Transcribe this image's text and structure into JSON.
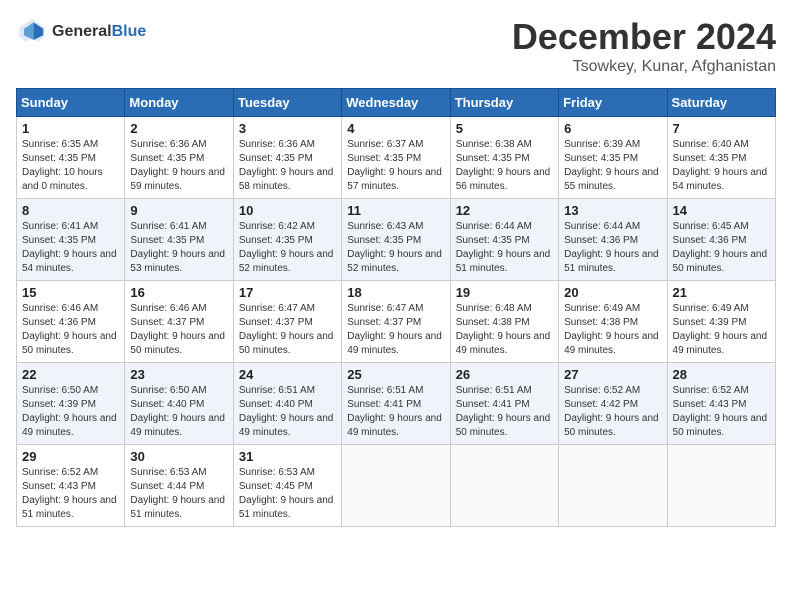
{
  "header": {
    "logo": {
      "general": "General",
      "blue": "Blue"
    },
    "title": "December 2024",
    "location": "Tsowkey, Kunar, Afghanistan"
  },
  "calendar": {
    "days_of_week": [
      "Sunday",
      "Monday",
      "Tuesday",
      "Wednesday",
      "Thursday",
      "Friday",
      "Saturday"
    ],
    "weeks": [
      [
        {
          "day": 1,
          "sunrise": "6:35 AM",
          "sunset": "4:35 PM",
          "daylight": "10 hours and 0 minutes."
        },
        {
          "day": 2,
          "sunrise": "6:36 AM",
          "sunset": "4:35 PM",
          "daylight": "9 hours and 59 minutes."
        },
        {
          "day": 3,
          "sunrise": "6:36 AM",
          "sunset": "4:35 PM",
          "daylight": "9 hours and 58 minutes."
        },
        {
          "day": 4,
          "sunrise": "6:37 AM",
          "sunset": "4:35 PM",
          "daylight": "9 hours and 57 minutes."
        },
        {
          "day": 5,
          "sunrise": "6:38 AM",
          "sunset": "4:35 PM",
          "daylight": "9 hours and 56 minutes."
        },
        {
          "day": 6,
          "sunrise": "6:39 AM",
          "sunset": "4:35 PM",
          "daylight": "9 hours and 55 minutes."
        },
        {
          "day": 7,
          "sunrise": "6:40 AM",
          "sunset": "4:35 PM",
          "daylight": "9 hours and 54 minutes."
        }
      ],
      [
        {
          "day": 8,
          "sunrise": "6:41 AM",
          "sunset": "4:35 PM",
          "daylight": "9 hours and 54 minutes."
        },
        {
          "day": 9,
          "sunrise": "6:41 AM",
          "sunset": "4:35 PM",
          "daylight": "9 hours and 53 minutes."
        },
        {
          "day": 10,
          "sunrise": "6:42 AM",
          "sunset": "4:35 PM",
          "daylight": "9 hours and 52 minutes."
        },
        {
          "day": 11,
          "sunrise": "6:43 AM",
          "sunset": "4:35 PM",
          "daylight": "9 hours and 52 minutes."
        },
        {
          "day": 12,
          "sunrise": "6:44 AM",
          "sunset": "4:35 PM",
          "daylight": "9 hours and 51 minutes."
        },
        {
          "day": 13,
          "sunrise": "6:44 AM",
          "sunset": "4:36 PM",
          "daylight": "9 hours and 51 minutes."
        },
        {
          "day": 14,
          "sunrise": "6:45 AM",
          "sunset": "4:36 PM",
          "daylight": "9 hours and 50 minutes."
        }
      ],
      [
        {
          "day": 15,
          "sunrise": "6:46 AM",
          "sunset": "4:36 PM",
          "daylight": "9 hours and 50 minutes."
        },
        {
          "day": 16,
          "sunrise": "6:46 AM",
          "sunset": "4:37 PM",
          "daylight": "9 hours and 50 minutes."
        },
        {
          "day": 17,
          "sunrise": "6:47 AM",
          "sunset": "4:37 PM",
          "daylight": "9 hours and 50 minutes."
        },
        {
          "day": 18,
          "sunrise": "6:47 AM",
          "sunset": "4:37 PM",
          "daylight": "9 hours and 49 minutes."
        },
        {
          "day": 19,
          "sunrise": "6:48 AM",
          "sunset": "4:38 PM",
          "daylight": "9 hours and 49 minutes."
        },
        {
          "day": 20,
          "sunrise": "6:49 AM",
          "sunset": "4:38 PM",
          "daylight": "9 hours and 49 minutes."
        },
        {
          "day": 21,
          "sunrise": "6:49 AM",
          "sunset": "4:39 PM",
          "daylight": "9 hours and 49 minutes."
        }
      ],
      [
        {
          "day": 22,
          "sunrise": "6:50 AM",
          "sunset": "4:39 PM",
          "daylight": "9 hours and 49 minutes."
        },
        {
          "day": 23,
          "sunrise": "6:50 AM",
          "sunset": "4:40 PM",
          "daylight": "9 hours and 49 minutes."
        },
        {
          "day": 24,
          "sunrise": "6:51 AM",
          "sunset": "4:40 PM",
          "daylight": "9 hours and 49 minutes."
        },
        {
          "day": 25,
          "sunrise": "6:51 AM",
          "sunset": "4:41 PM",
          "daylight": "9 hours and 49 minutes."
        },
        {
          "day": 26,
          "sunrise": "6:51 AM",
          "sunset": "4:41 PM",
          "daylight": "9 hours and 50 minutes."
        },
        {
          "day": 27,
          "sunrise": "6:52 AM",
          "sunset": "4:42 PM",
          "daylight": "9 hours and 50 minutes."
        },
        {
          "day": 28,
          "sunrise": "6:52 AM",
          "sunset": "4:43 PM",
          "daylight": "9 hours and 50 minutes."
        }
      ],
      [
        {
          "day": 29,
          "sunrise": "6:52 AM",
          "sunset": "4:43 PM",
          "daylight": "9 hours and 51 minutes."
        },
        {
          "day": 30,
          "sunrise": "6:53 AM",
          "sunset": "4:44 PM",
          "daylight": "9 hours and 51 minutes."
        },
        {
          "day": 31,
          "sunrise": "6:53 AM",
          "sunset": "4:45 PM",
          "daylight": "9 hours and 51 minutes."
        },
        null,
        null,
        null,
        null
      ]
    ]
  }
}
